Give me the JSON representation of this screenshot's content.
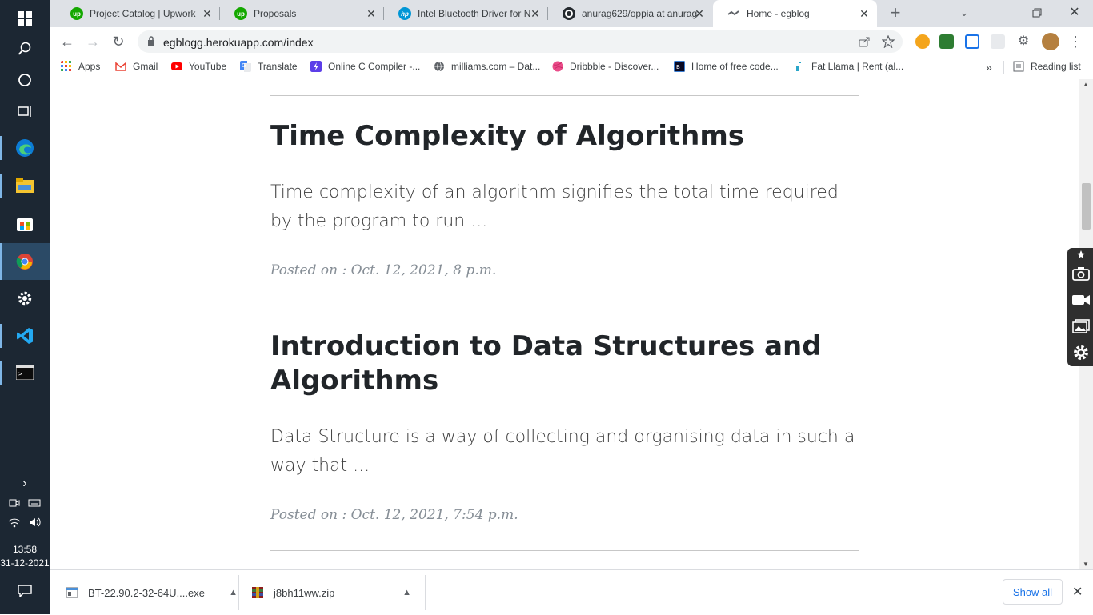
{
  "taskbar": {
    "icons": [
      "windows-start-icon",
      "search-icon",
      "cortana-icon",
      "task-view-icon",
      "edge-icon",
      "file-explorer-icon",
      "store-icon",
      "chrome-icon",
      "settings-icon",
      "vscode-icon",
      "terminal-icon"
    ],
    "time": "13:58",
    "date": "31-12-2021"
  },
  "tabs": [
    {
      "title": "Project Catalog | Upwork",
      "icon": "upwork-icon"
    },
    {
      "title": "Proposals",
      "icon": "upwork-icon"
    },
    {
      "title": "Intel Bluetooth Driver for N",
      "icon": "hp-icon"
    },
    {
      "title": "anurag629/oppia at anurag",
      "icon": "github-icon"
    },
    {
      "title": "Home - egblog",
      "icon": "egblog-icon"
    }
  ],
  "toolbar": {
    "url": "egblogg.herokuapp.com/index"
  },
  "bookmarks": [
    {
      "label": "Apps",
      "icon": "apps-grid-icon"
    },
    {
      "label": "Gmail",
      "icon": "gmail-icon"
    },
    {
      "label": "YouTube",
      "icon": "youtube-icon"
    },
    {
      "label": "Translate",
      "icon": "translate-icon"
    },
    {
      "label": "Online C Compiler -...",
      "icon": "compiler-icon"
    },
    {
      "label": "milliams.com – Dat...",
      "icon": "globe-icon"
    },
    {
      "label": "Dribbble - Discover...",
      "icon": "dribbble-icon"
    },
    {
      "label": "Home of free code...",
      "icon": "freecodecamp-icon"
    },
    {
      "label": "Fat Llama | Rent (al...",
      "icon": "fat-llama-icon"
    }
  ],
  "reading_list": "Reading list",
  "posts": [
    {
      "title": "Time Complexity of Algorithms",
      "excerpt": "Time complexity of an algorithm signifies the total time required by the program to run ...",
      "meta": "Posted on : Oct. 12, 2021, 8 p.m."
    },
    {
      "title": "Introduction to Data Structures and Algorithms",
      "excerpt": "Data Structure is a way of collecting and organising data in such a way that ...",
      "meta": "Posted on : Oct. 12, 2021, 7:54 p.m."
    }
  ],
  "downloads": [
    {
      "name": "BT-22.90.2-32-64U....exe",
      "icon": "exe-file-icon"
    },
    {
      "name": "j8bh11ww.zip",
      "icon": "zip-file-icon"
    }
  ],
  "show_all": "Show all",
  "colors": {
    "taskbar": "#1c2733",
    "tabstrip": "#dee1e6",
    "title": "#212529",
    "meta": "#868e96",
    "link": "#1a73e8"
  }
}
